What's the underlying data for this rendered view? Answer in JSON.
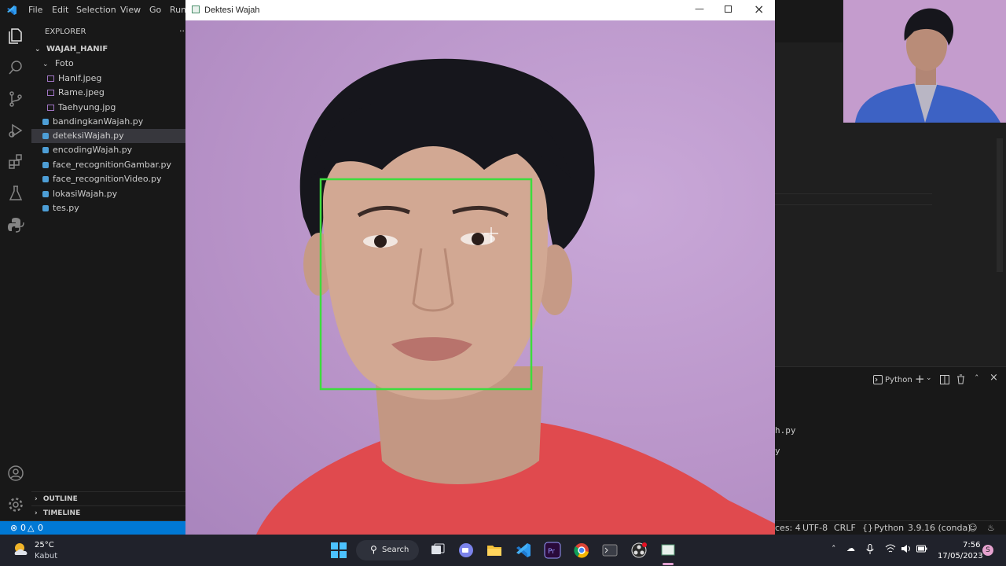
{
  "vscode": {
    "menu": [
      "File",
      "Edit",
      "Selection",
      "View",
      "Go",
      "Run"
    ],
    "explorer_title": "EXPLORER",
    "explorer_more": "...",
    "root_folder": "WAJAH_HANIF",
    "tree": [
      {
        "label": "Foto",
        "kind": "folder"
      },
      {
        "label": "Hanif.jpeg",
        "kind": "image"
      },
      {
        "label": "Rame.jpeg",
        "kind": "image"
      },
      {
        "label": "Taehyung.jpg",
        "kind": "image"
      },
      {
        "label": "bandingkanWajah.py",
        "kind": "python"
      },
      {
        "label": "deteksiWajah.py",
        "kind": "python",
        "active": true
      },
      {
        "label": "encodingWajah.py",
        "kind": "python"
      },
      {
        "label": "face_recognitionGambar.py",
        "kind": "python"
      },
      {
        "label": "face_recognitionVideo.py",
        "kind": "python"
      },
      {
        "label": "lokasiWajah.py",
        "kind": "python"
      },
      {
        "label": "tes.py",
        "kind": "python"
      }
    ],
    "outline_label": "OUTLINE",
    "timeline_label": "TIMELINE",
    "panel": {
      "terminal_label": "Python",
      "line1": "h.py",
      "line2": "y"
    },
    "status": {
      "errors": "0",
      "warnings": "0",
      "spaces": "ces: 4",
      "encoding": "UTF-8",
      "eol": "CRLF",
      "language": "Python",
      "interpreter": "3.9.16 (conda)"
    }
  },
  "cv_window": {
    "title": "Dektesi Wajah",
    "box_color": "#3ddc3d"
  },
  "taskbar": {
    "weather_temp": "25°C",
    "weather_desc": "Kabut",
    "search_label": "Search",
    "time": "7:56",
    "date": "17/05/2023",
    "user_initial": "S"
  },
  "colors": {
    "vscode_blue": "#0078d4",
    "python_icon": "#4d9ed6",
    "image_icon": "#a074c4"
  }
}
